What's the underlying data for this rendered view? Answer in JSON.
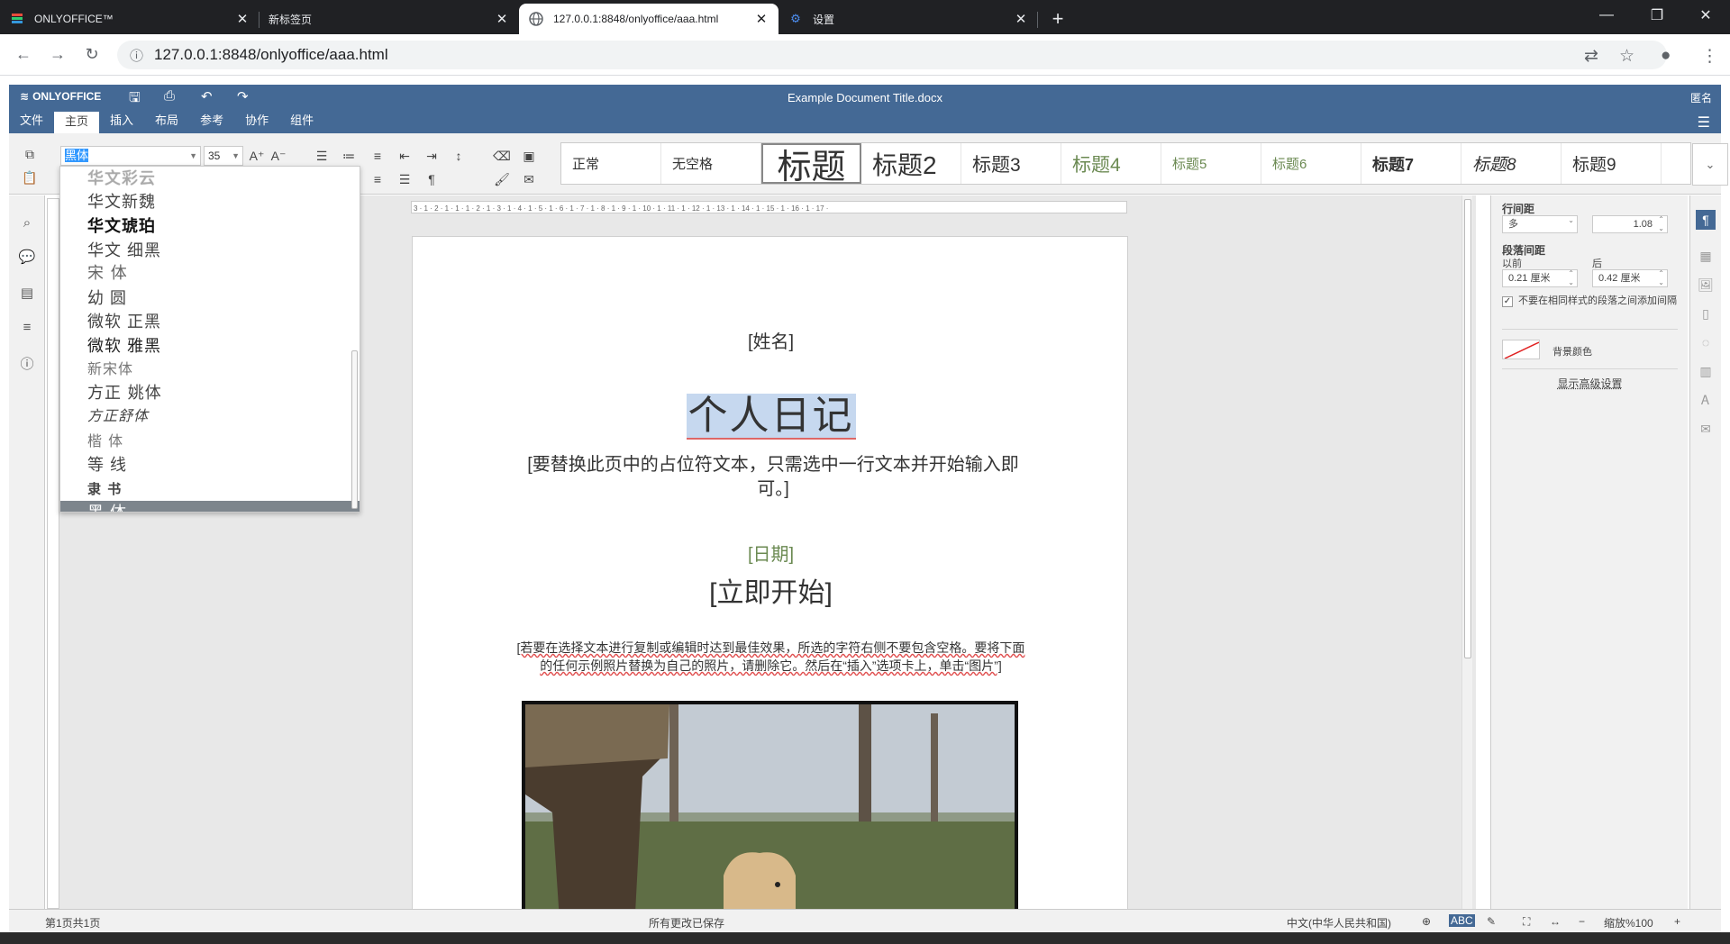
{
  "browser": {
    "tabs": [
      {
        "label": "ONLYOFFICE™",
        "icon": "onlyoffice-logo-icon",
        "active": false
      },
      {
        "label": "新标签页",
        "icon": "",
        "active": false
      },
      {
        "label": "127.0.0.1:8848/onlyoffice/aaa.html",
        "icon": "globe-icon",
        "active": true
      },
      {
        "label": "设置",
        "icon": "gear-icon",
        "active": false
      }
    ],
    "url": "127.0.0.1:8848/onlyoffice/aaa.html"
  },
  "app": {
    "logo": "ONLYOFFICE",
    "doc_title": "Example Document Title.docx",
    "user": "匿名",
    "menu_tabs": [
      "文件",
      "主页",
      "插入",
      "布局",
      "参考",
      "协作",
      "组件"
    ],
    "active_tab": "主页",
    "accent": "#446995"
  },
  "ribbon": {
    "font_name": "黑体",
    "font_size": "35",
    "styles": [
      "正常",
      "无空格",
      "标题",
      "标题2",
      "标题3",
      "标题4",
      "标题5",
      "标题6",
      "标题7",
      "标题8",
      "标题9"
    ]
  },
  "font_list": [
    "华文彩云",
    "华文新魏",
    "华文琥珀",
    "华文 细黑",
    "宋 体",
    "幼 圆",
    "微软 正黑",
    "微软 雅黑",
    "新宋体",
    "方正 姚体",
    "方正舒体",
    "楷 体",
    "等 线",
    "隶 书",
    "黑 体"
  ],
  "font_selected": "黑 体",
  "ruler_ticks": "3 · 1 · 2 · 1 · 1 · 1 · 2 · 1 · 3 · 1 · 4 · 1 · 5 · 1 · 6 · 1 · 7 · 1 · 8 · 1 · 9 · 1 · 10 · 1 · 11 · 1 · 12 · 1 · 13 · 1 · 14 · 1 · 15 · 1 · 16 · 1 · 17 ·",
  "document": {
    "name_placeholder": "[姓名]",
    "title": "个人日记",
    "subtitle": "[要替换此页中的占位符文本，只需选中一行文本并开始输入即可。]",
    "date": "[日期]",
    "start": "[立即开始]",
    "instructions": "[若要在选择文本进行复制或编辑时达到最佳效果，所选的字符右侧不要包含空格。要将下面的任何示例照片替换为自己的照片，请删除它。然后在“插入”选项卡上，单击“图片”]"
  },
  "panel": {
    "line_spacing_label": "行间距",
    "line_spacing_mode": "多",
    "line_spacing_value": "1.08",
    "para_spacing_label": "段落间距",
    "before_label": "以前",
    "after_label": "后",
    "before_value": "0.21 厘米",
    "after_value": "0.42 厘米",
    "no_space_same_style": "不要在相同样式的段落之间添加间隔",
    "background_color": "背景颜色",
    "advanced": "显示高级设置"
  },
  "status": {
    "page": "第1页共1页",
    "saved": "所有更改已保存",
    "language": "中文(中华人民共和国)",
    "zoom": "缩放%100"
  }
}
